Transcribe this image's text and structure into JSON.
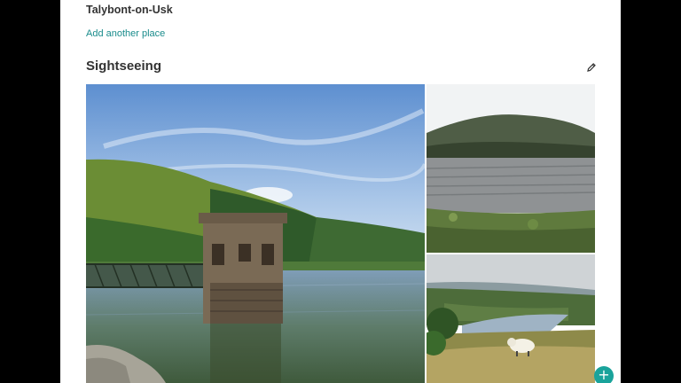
{
  "itinerary": {
    "place_name": "Talybont-on-Usk",
    "add_place_label": "Add another place"
  },
  "sightseeing": {
    "title": "Sightseeing",
    "edit_icon": "pencil-icon",
    "photos": [
      {
        "name": "reservoir-valve-tower-photo"
      },
      {
        "name": "lake-and-hill-photo"
      },
      {
        "name": "valley-with-sheep-photo"
      }
    ]
  },
  "fab": {
    "icon": "plus-icon",
    "label": "+"
  },
  "colors": {
    "accent": "#1aa39b",
    "link": "#1a8c8c",
    "text": "#333333"
  }
}
